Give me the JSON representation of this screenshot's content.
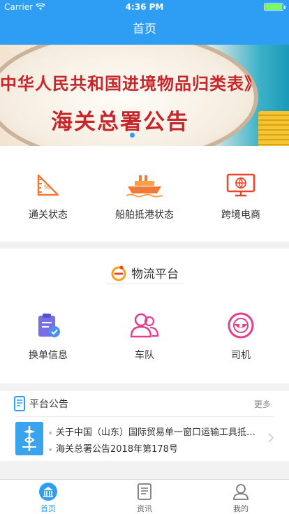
{
  "status_bar": {
    "carrier": "Carrier",
    "time": "4:36 PM"
  },
  "nav": {
    "title": "首页"
  },
  "banner": {
    "line1": "中华人民共和国进境物品归类表》",
    "line2": "海关总署公告"
  },
  "quick_links": [
    {
      "label": "通关状态",
      "icon": "clearance-status-icon"
    },
    {
      "label": "船舶抵港状态",
      "icon": "ship-icon"
    },
    {
      "label": "跨境电商",
      "icon": "monitor-globe-icon"
    }
  ],
  "logistics": {
    "title": "物流平台",
    "items": [
      {
        "label": "换单信息",
        "icon": "clipboard-check-icon"
      },
      {
        "label": "车队",
        "icon": "people-icon"
      },
      {
        "label": "司机",
        "icon": "steering-wheel-icon"
      }
    ]
  },
  "notices": {
    "title": "平台公告",
    "more": "更多",
    "items": [
      "关于中国（山东）国际贸易单一窗口运输工具抵…",
      "海关总署公告2018年第178号"
    ]
  },
  "tabbar": [
    {
      "label": "首页",
      "active": true
    },
    {
      "label": "资讯",
      "active": false
    },
    {
      "label": "我的",
      "active": false
    }
  ],
  "colors": {
    "primary": "#2d9ef3",
    "orange": "#f07a3a",
    "purple": "#7a6ee6",
    "pink": "#e63c8c"
  }
}
